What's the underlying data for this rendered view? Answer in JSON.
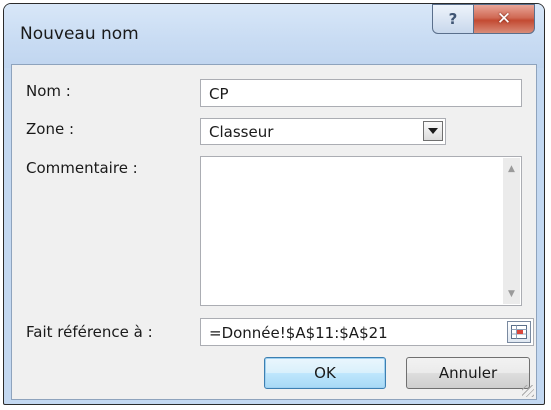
{
  "dialog": {
    "title": "Nouveau nom",
    "help_glyph": "?",
    "close_glyph": "✕"
  },
  "fields": {
    "name": {
      "label": "Nom :",
      "value": "CP"
    },
    "scope": {
      "label": "Zone :",
      "value": "Classeur"
    },
    "comment": {
      "label": "Commentaire :",
      "value": ""
    },
    "refers_to": {
      "label": "Fait référence à :",
      "value": "=Donnée!$A$11:$A$21"
    }
  },
  "buttons": {
    "ok": "OK",
    "cancel": "Annuler"
  },
  "icons": {
    "help": "question-icon",
    "close": "close-icon",
    "dropdown": "chevron-down-icon",
    "collapse_dialog": "range-select-icon"
  },
  "colors": {
    "titlebar": "#c9dcf3",
    "close_button": "#c34a32",
    "default_button_border": "#3c7fb1"
  }
}
